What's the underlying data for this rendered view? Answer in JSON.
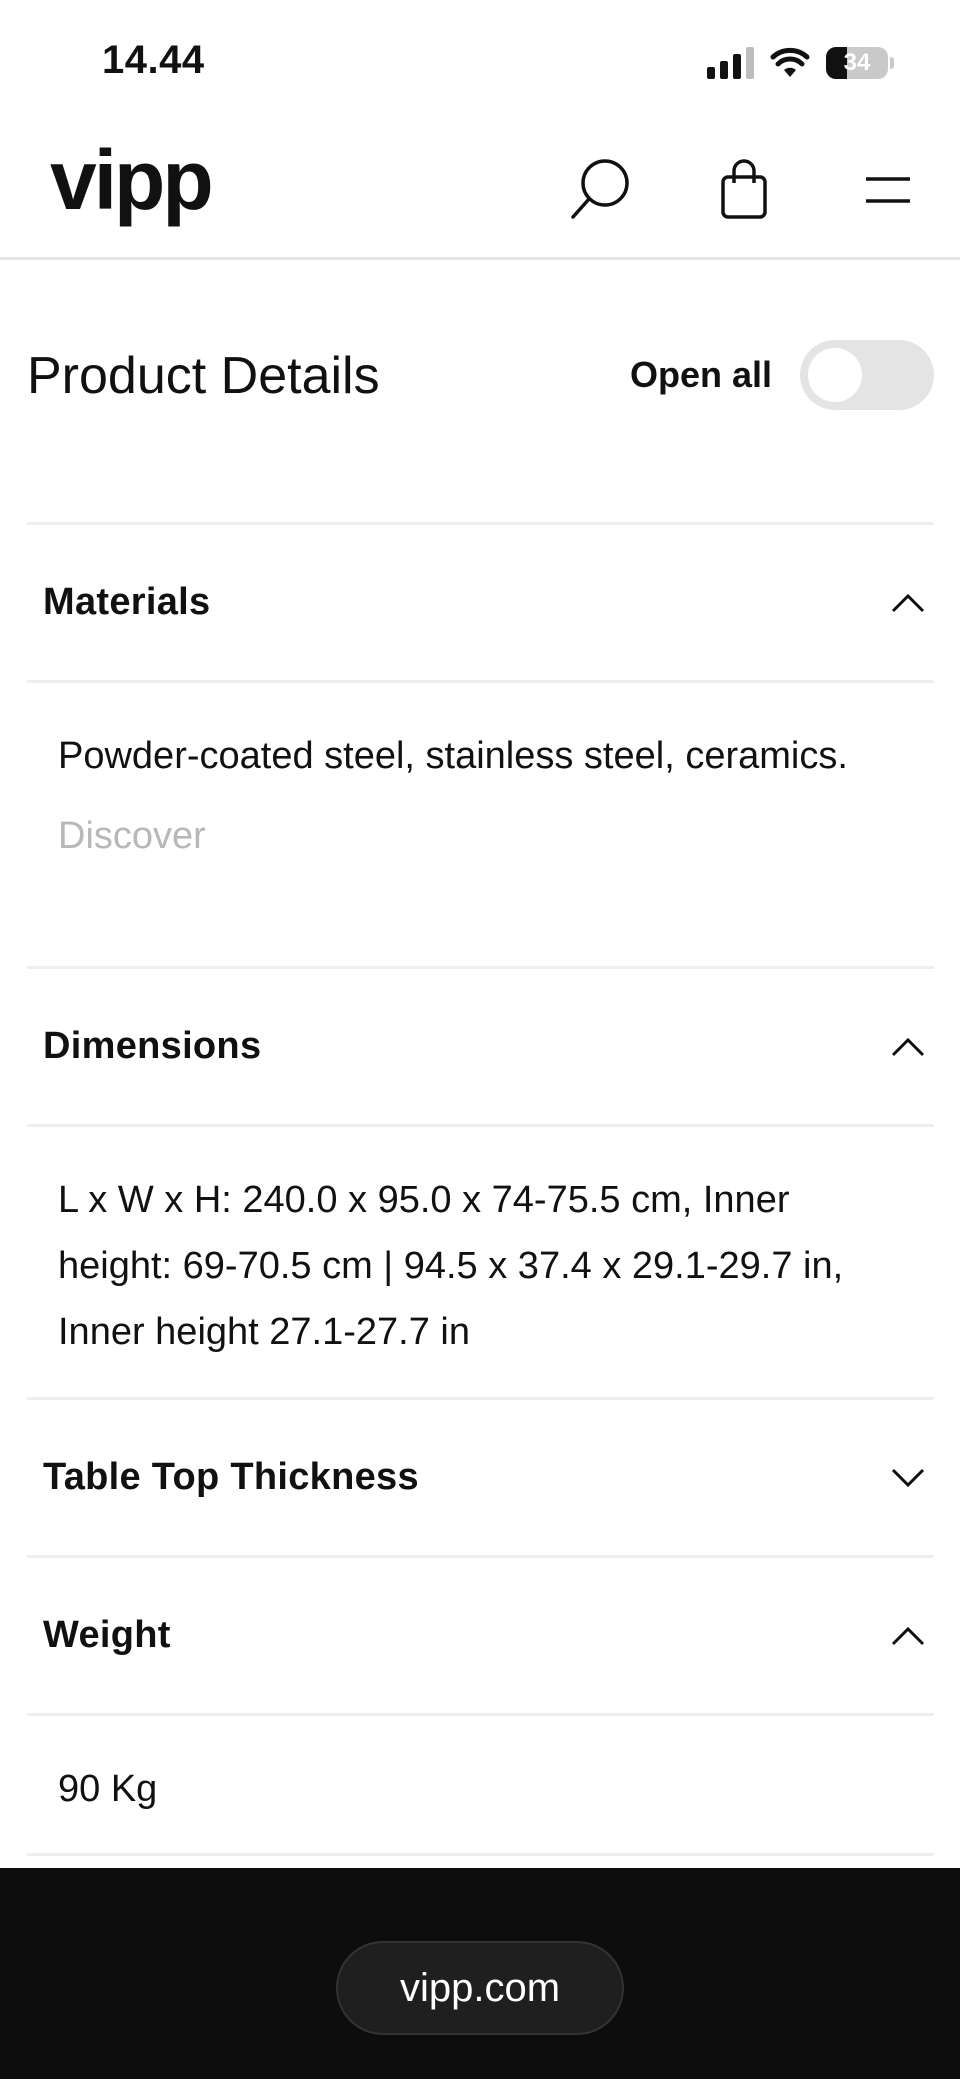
{
  "status_bar": {
    "time": "14.44",
    "battery": "34",
    "icons": [
      "signal-icon",
      "wifi-icon",
      "battery-icon"
    ]
  },
  "header": {
    "logo": "vipp",
    "icons": [
      "search-icon",
      "shopping-bag-icon",
      "menu-icon"
    ]
  },
  "product_details": {
    "title": "Product Details",
    "open_all_label": "Open all",
    "open_all_on": false
  },
  "accordion": [
    {
      "title": "Materials",
      "expanded": true,
      "body": "Powder-coated steel, stainless steel, ceramics.",
      "link": "Discover"
    },
    {
      "title": "Dimensions",
      "expanded": true,
      "body": "L x W x H: 240.0 x 95.0 x 74-75.5 cm, Inner height: 69-70.5 cm | 94.5 x 37.4 x 29.1-29.7 in, Inner height 27.1-27.7 in"
    },
    {
      "title": "Table Top Thickness",
      "expanded": false
    },
    {
      "title": "Weight",
      "expanded": true,
      "body": "90 Kg"
    }
  ],
  "browser": {
    "url": "vipp.com"
  },
  "colors": {
    "text": "#111111",
    "muted_link": "#b8b8b8",
    "divider": "#eeeeee",
    "toggle_off": "#e4e4e4",
    "browser_bar": "#0d0d0d"
  }
}
